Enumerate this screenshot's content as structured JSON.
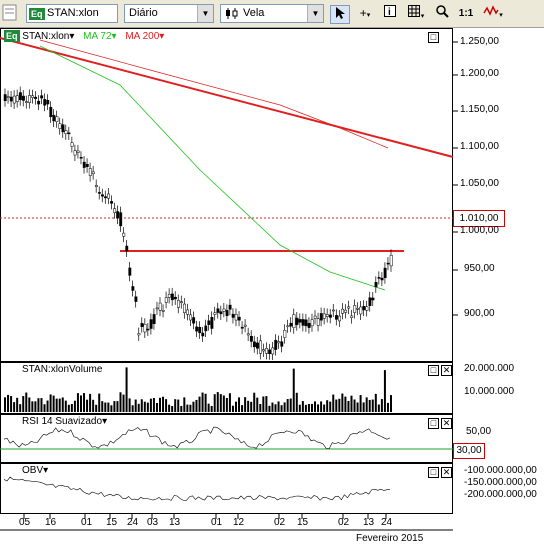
{
  "toolbar": {
    "symbol_badge": "Eq",
    "symbol_value": "STAN:xlon",
    "period_value": "Diário",
    "chart_type_icon": "candle-icon",
    "chart_type_value": "Vela",
    "zoom_label": "1:1"
  },
  "main_pane": {
    "title_badge": "Eq",
    "title": "STAN:xlon",
    "ma72_label": "MA 72",
    "ma200_label": "MA 200",
    "ma72_color": "#20c020",
    "ma200_color": "#e02020",
    "last_price_badge": "1.010,00",
    "y_ticks": [
      "1.250,00",
      "1.200,00",
      "1.150,00",
      "1.100,00",
      "1.050,00",
      "1.000,00",
      "950,00",
      "900,00"
    ]
  },
  "volume_pane": {
    "title": "STAN:xlonVolume",
    "y_ticks": [
      "20.000.000",
      "10.000.000"
    ]
  },
  "rsi_pane": {
    "title": "RSI 14 Suavizado",
    "y_ticks": [
      "50,00"
    ],
    "level_badge": "30,00"
  },
  "obv_pane": {
    "title": "OBV",
    "y_ticks": [
      "-100.000.000,00",
      "-150.000.000,00",
      "-200.000.000,00"
    ]
  },
  "x_axis": {
    "ticks": [
      "05",
      "16",
      "01",
      "15",
      "24",
      "03",
      "13",
      "01",
      "12",
      "02",
      "15",
      "02",
      "13",
      "24"
    ],
    "month_label": "Fevereiro 2015"
  }
}
